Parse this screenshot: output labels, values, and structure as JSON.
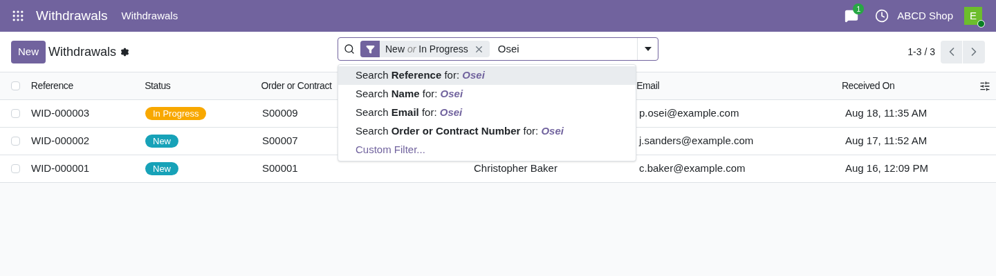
{
  "navbar": {
    "app_title": "Withdrawals",
    "menu": [
      {
        "label": "Withdrawals"
      }
    ],
    "messages_badge": "1",
    "company": "ABCD Shop",
    "avatar": {
      "initial": "E",
      "online": true
    }
  },
  "control_panel": {
    "new_button": "New",
    "title": "Withdrawals",
    "pager": "1-3 / 3"
  },
  "search": {
    "facet": {
      "parts": [
        "New",
        "or",
        "In Progress"
      ]
    },
    "value": "Osei"
  },
  "search_suggestions": [
    {
      "kind": "field",
      "prefix": "Search",
      "field": "Reference",
      "middle": "for:",
      "term": "Osei",
      "selected": true
    },
    {
      "kind": "field",
      "prefix": "Search",
      "field": "Name",
      "middle": "for:",
      "term": "Osei",
      "selected": false
    },
    {
      "kind": "field",
      "prefix": "Search",
      "field": "Email",
      "middle": "for:",
      "term": "Osei",
      "selected": false
    },
    {
      "kind": "field",
      "prefix": "Search",
      "field": "Order or Contract Number",
      "middle": "for:",
      "term": "Osei",
      "selected": false
    },
    {
      "kind": "link",
      "label": "Custom Filter...",
      "selected": false
    }
  ],
  "table": {
    "select_all": {
      "checked": false
    },
    "columns": [
      "Reference",
      "Status",
      "Order or Contract",
      "Email",
      "Received On"
    ],
    "rows": [
      {
        "reference": "WID-000003",
        "status": {
          "label": "In Progress",
          "color": "#f8a800"
        },
        "order": "S00009",
        "email": "p.osei@example.com",
        "received": "Aug 18, 11:35 AM",
        "checked": false
      },
      {
        "reference": "WID-000002",
        "status": {
          "label": "New",
          "color": "#17a2b8"
        },
        "order": "S00007",
        "email": "j.sanders@example.com",
        "received": "Aug 17, 11:52 AM",
        "checked": false
      },
      {
        "reference": "WID-000001",
        "status": {
          "label": "New",
          "color": "#17a2b8"
        },
        "order": "S00001",
        "name": "Christopher Baker",
        "email": "c.baker@example.com",
        "received": "Aug 16, 12:09 PM",
        "checked": false
      }
    ]
  }
}
